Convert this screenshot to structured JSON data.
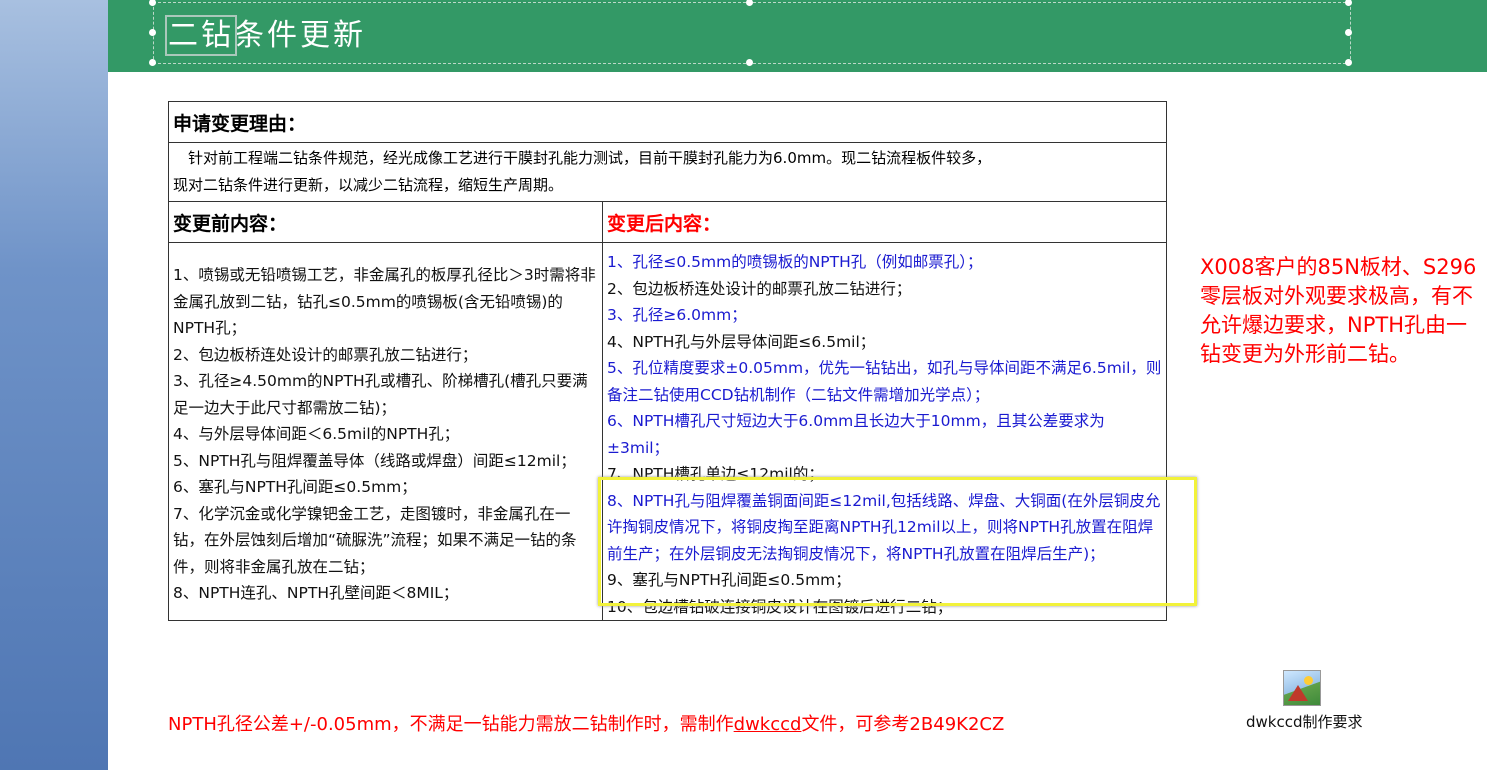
{
  "slide": {
    "title_highlight": "二钻",
    "title_rest": "条件更新"
  },
  "table": {
    "reason_header": "申请变更理由：",
    "reason_text_1": "　针对前工程端二钻条件规范，经光成像工艺进行干膜封孔能力测试，目前干膜封孔能力为6.0mm。现二钻流程板件较多，",
    "reason_text_2": "现对二钻条件进行更新，以减少二钻流程，缩短生产周期。",
    "before_header": "变更前内容：",
    "after_header": "变更后内容：",
    "before_items": [
      "1、喷锡或无铅喷锡工艺，非金属孔的板厚孔径比＞3时需将非金属孔放到二钻，钻孔≤0.5mm的喷锡板(含无铅喷锡)的NPTH孔；",
      "2、包边板桥连处设计的邮票孔放二钻进行；",
      "3、孔径≥4.50mm的NPTH孔或槽孔、阶梯槽孔(槽孔只要满足一边大于此尺寸都需放二钻)；",
      "4、与外层导体间距＜6.5mil的NPTH孔；",
      "5、NPTH孔与阻焊覆盖导体（线路或焊盘）间距≤12mil；",
      "6、塞孔与NPTH孔间距≤0.5mm；",
      "7、化学沉金或化学镍钯金工艺，走图镀时，非金属孔在一钻，在外层蚀刻后增加“硫脲洗”流程；如果不满足一钻的条件，则将非金属孔放在二钻；",
      "8、NPTH连孔、NPTH孔壁间距＜8MIL；"
    ],
    "after_items": [
      "1、孔径≤0.5mm的喷锡板的NPTH孔（例如邮票孔）；",
      "2、包边板桥连处设计的邮票孔放二钻进行；",
      "3、孔径≥6.0mm；",
      "4、NPTH孔与外层导体间距≤6.5mil；",
      "5、孔位精度要求±0.05mm，优先一钻钻出，如孔与导体间距不满足6.5mil，则备注二钻使用CCD钻机制作（二钻文件需增加光学点）；",
      "6、NPTH槽孔尺寸短边大于6.0mm且长边大于10mm，且其公差要求为±3mil；",
      "7、NPTH槽孔单边≤12mil的；",
      "8、NPTH孔与阻焊覆盖铜面间距≤12mil,包括线路、焊盘、大铜面(在外层铜皮允许掏铜皮情况下，将铜皮掏至距离NPTH孔12mil以上，则将NPTH孔放置在阻焊前生产；在外层铜皮无法掏铜皮情况下，将NPTH孔放置在阻焊后生产)；",
      "9、塞孔与NPTH孔间距≤0.5mm；",
      "10、包边槽钻破连接铜皮设计在图镀后进行二钻；"
    ]
  },
  "side_note": "X008客户的85N板材、S296零层板对外观要求极高，有不允许爆边要求，NPTH孔由一钻变更为外形前二钻。",
  "bottom_note": {
    "part1": "NPTH孔径公差+/-0.05mm，不满足一钻能力需放二钻制作时，需制作",
    "link": "dwkccd",
    "part2": "文件，可参考2B49K2CZ"
  },
  "attachment": {
    "label": "dwkccd制作要求",
    "icon": "image-file-icon"
  },
  "colors": {
    "banner": "#339966",
    "red_text": "#ff0000",
    "blue_text": "#1a1ad0",
    "highlight_box": "#f2f23a"
  }
}
